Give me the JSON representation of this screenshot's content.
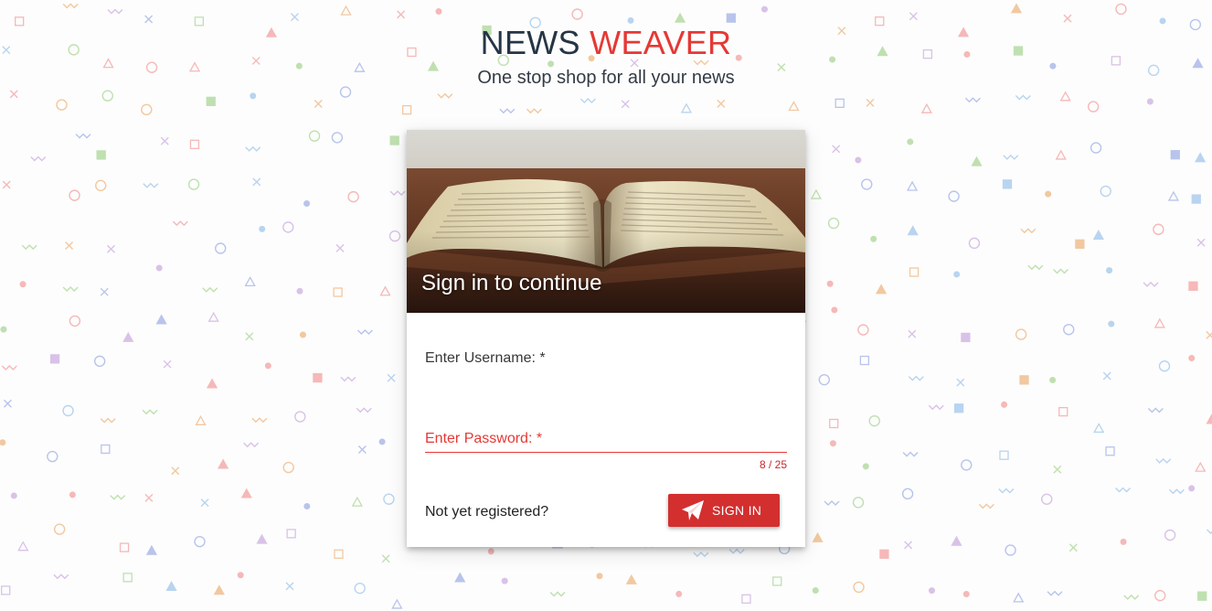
{
  "app": {
    "title_part1": "NEWS",
    "title_part2": "WEAVER",
    "subtitle": "One stop shop for all your news"
  },
  "card": {
    "header_title": "Sign in to continue"
  },
  "form": {
    "username": {
      "label": "Enter Username: *",
      "value": ""
    },
    "password": {
      "label": "Enter Password: *",
      "value": "",
      "counter": "8 / 25"
    },
    "register_text": "Not yet registered?",
    "signin_label": "SIGN IN",
    "signin_icon": "paper-plane-icon"
  },
  "colors": {
    "accent": "#e53935",
    "button": "#d32f2f",
    "title_dark": "#263545"
  }
}
